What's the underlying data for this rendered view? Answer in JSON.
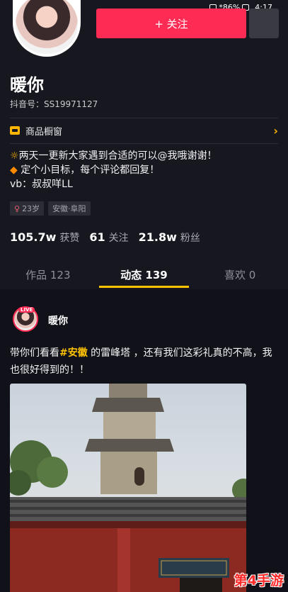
{
  "status_bar": {
    "signal": "*86%",
    "time": "4:17"
  },
  "header": {
    "follow_label": "+ 关注"
  },
  "profile": {
    "name": "暖你",
    "uid": "抖音号：SS19971127",
    "shop_label": "商品橱窗",
    "bio": {
      "line1_icon": "☼",
      "line1": "两天一更新大家遇到合适的可以@我哦谢谢！",
      "line2_icon": "◆",
      "line2": "定个小目标，每个评论都回复！",
      "line3": "vb：叔叔咩LL"
    },
    "tags": [
      {
        "label": "23岁"
      },
      {
        "label": "安徽·阜阳"
      }
    ],
    "stats": [
      {
        "value": "105.7w",
        "label": "获赞"
      },
      {
        "value": "61",
        "label": "关注"
      },
      {
        "value": "21.8w",
        "label": "粉丝"
      }
    ]
  },
  "tabs": [
    {
      "label": "作品 123"
    },
    {
      "label": "动态 139"
    },
    {
      "label": "喜欢 0"
    }
  ],
  "post": {
    "live_badge": "LIVE",
    "author": "暖你",
    "text_before": "带你们看看",
    "hashtag": "#安徽",
    "text_after": " 的雷峰塔 ，还有我们这彩礼真的不高，我也很好得到的！！"
  },
  "watermark": "第4手游"
}
